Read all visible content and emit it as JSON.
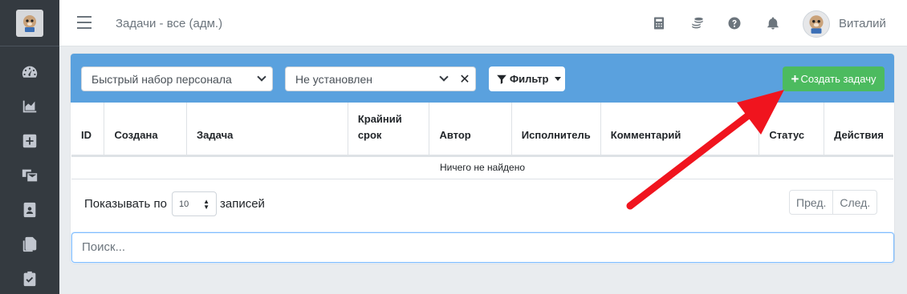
{
  "header": {
    "title": "Задачи - все (адм.)",
    "user_name": "Виталий"
  },
  "sidebar": {
    "items": [
      {
        "icon": "dashboard-icon"
      },
      {
        "icon": "chart-area-icon"
      },
      {
        "icon": "plus-square-icon"
      },
      {
        "icon": "mail-bulk-icon"
      },
      {
        "icon": "id-badge-icon"
      },
      {
        "icon": "copy-icon"
      },
      {
        "icon": "clipboard-check-icon"
      }
    ]
  },
  "toolbar": {
    "staff_select_value": "Быстрый набор персонала",
    "status_select_value": "Не установлен",
    "clear_label": "✕",
    "filter_label": "Фильтр",
    "create_label": "Создать задачу"
  },
  "table": {
    "columns": [
      "ID",
      "Создана",
      "Задача",
      "Крайний срок",
      "Автор",
      "Исполнитель",
      "Комментарий",
      "Статус",
      "Действия"
    ],
    "empty_text": "Ничего не найдено"
  },
  "footer": {
    "show_prefix": "Показывать по",
    "page_length": "10",
    "show_suffix": "записей",
    "prev_label": "Пред.",
    "next_label": "След."
  },
  "search": {
    "placeholder": "Поиск..."
  },
  "colors": {
    "sidebar": "#343a40",
    "toolbar": "#5aa1de",
    "create_button": "#4cbb5f",
    "annotation_arrow": "#f0141e"
  }
}
